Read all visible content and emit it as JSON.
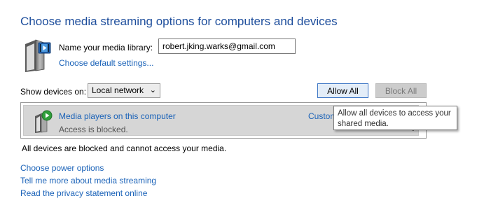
{
  "header": {
    "title": "Choose media streaming options for computers and devices"
  },
  "library": {
    "name_label": "Name your media library:",
    "name_value": "robert.jking.warks@gmail.com",
    "default_settings_link": "Choose default settings...",
    "icon": "media-server-icon"
  },
  "devices_filter": {
    "label": "Show devices on:",
    "selected": "Local network",
    "allow_all_label": "Allow All",
    "block_all_label": "Block All"
  },
  "device_list": {
    "items": [
      {
        "name": "Media players on this computer",
        "status": "Access is blocked.",
        "customize_label": "Custom",
        "icon": "media-player-computer-icon"
      }
    ]
  },
  "tooltip": {
    "text": "Allow all devices to access your shared media."
  },
  "status_message": "All devices are blocked and cannot access your media.",
  "footer_links": [
    "Choose power options",
    "Tell me more about media streaming",
    "Read the privacy statement online"
  ],
  "colors": {
    "title": "#1e4e9c",
    "link": "#1a62b8",
    "row_selected": "#d6d6d6",
    "button_focus_border": "#3a74c4"
  }
}
